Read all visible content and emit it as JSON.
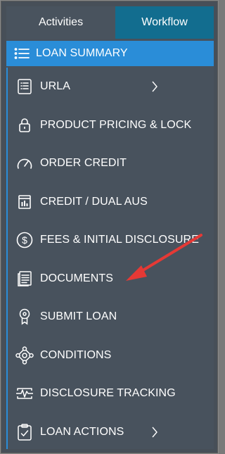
{
  "tabs": {
    "activities": "Activities",
    "workflow": "Workflow"
  },
  "menu": {
    "loan_summary": "LOAN SUMMARY",
    "urla": "URLA",
    "product_pricing": "PRODUCT PRICING & LOCK",
    "order_credit": "ORDER CREDIT",
    "credit_dual_aus": "CREDIT / DUAL AUS",
    "fees_disclosure": "FEES & INITIAL DISCLOSURE",
    "documents": "DOCUMENTS",
    "submit_loan": "SUBMIT LOAN",
    "conditions": "CONDITIONS",
    "disclosure_tracking": "DISCLOSURE TRACKING",
    "loan_actions": "LOAN ACTIONS"
  },
  "icons": {
    "loan_summary": "list-icon",
    "urla": "form-icon",
    "product_pricing": "lock-icon",
    "order_credit": "gauge-icon",
    "credit_dual_aus": "bar-chart-icon",
    "fees_disclosure": "dollar-circle-icon",
    "documents": "document-icon",
    "submit_loan": "ribbon-icon",
    "conditions": "network-icon",
    "disclosure_tracking": "pulse-icon",
    "loan_actions": "clipboard-check-icon"
  },
  "colors": {
    "panel": "#48525d",
    "active": "#2a8dd8",
    "workflow_tab": "#126d8f",
    "annotation": "#e53935"
  }
}
